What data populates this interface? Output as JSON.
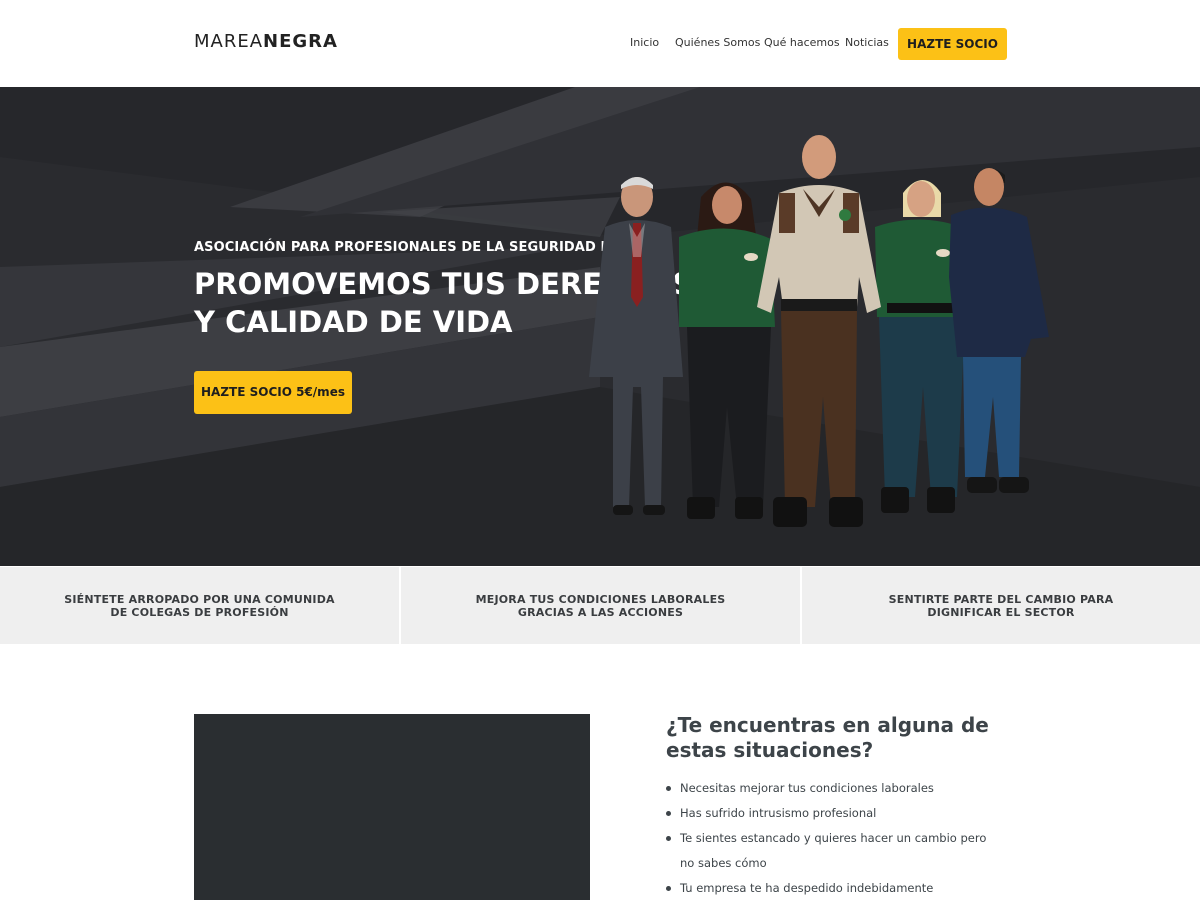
{
  "header": {
    "logo_light": "MAREA",
    "logo_bold": "NEGRA",
    "nav": [
      {
        "label": "Inicio"
      },
      {
        "label": "Quiénes Somos"
      },
      {
        "label": "Qué hacemos"
      },
      {
        "label": "Noticias"
      }
    ],
    "cta_label": "HAZTE SOCIO"
  },
  "hero": {
    "kicker": "ASOCIACIÓN PARA PROFESIONALES DE LA SEGURIDAD PRIVADA",
    "title_line1": "PROMOVEMOS TUS DERECHOS",
    "title_line2": "Y CALIDAD DE VIDA",
    "cta_label": "HAZTE SOCIO 5€/mes"
  },
  "benefits": [
    {
      "text": "SIÉNTETE ARROPADO POR UNA COMUNIDA\nDE COLEGAS DE PROFESIÓN"
    },
    {
      "text": "MEJORA TUS CONDICIONES LABORALES\nGRACIAS A LAS ACCIONES"
    },
    {
      "text": "SENTIRTE PARTE DEL CAMBIO PARA\nDIGNIFICAR EL SECTOR"
    }
  ],
  "situations": {
    "title": "¿Te encuentras en alguna de\nestas situaciones?",
    "items": [
      "Necesitas mejorar tus condiciones laborales",
      "Has sufrido intrusismo profesional",
      "Te sientes estancado y quieres hacer un cambio pero no sabes cómo",
      "Tu empresa te ha despedido indebidamente"
    ]
  },
  "colors": {
    "accent": "#fcc116",
    "hero_bg": "#2a2b2f",
    "strip_bg": "#efefef",
    "video_bg": "#2a2e31"
  }
}
